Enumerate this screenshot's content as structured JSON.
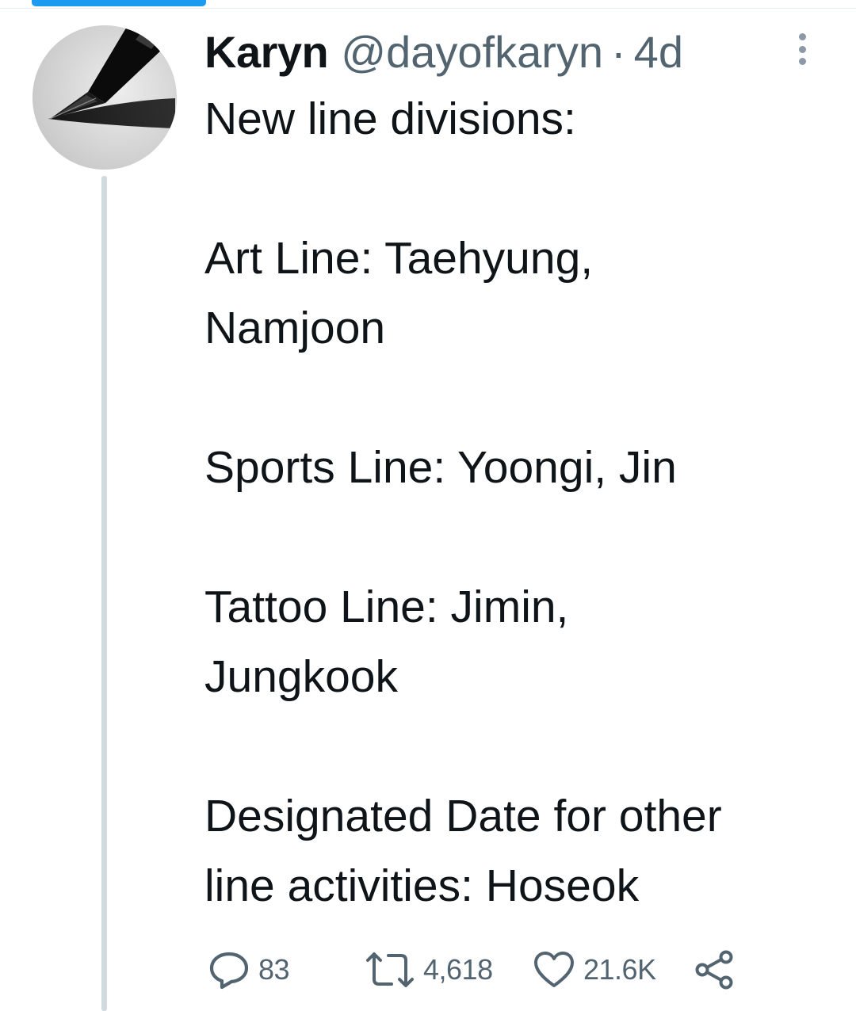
{
  "tweet": {
    "author_name": "Karyn",
    "handle": "@dayofkaryn",
    "separator": "·",
    "time": "4d",
    "text_lines": [
      "New line divisions:",
      "",
      "Art Line: Taehyung,",
      "Namjoon",
      "",
      "Sports Line: Yoongi, Jin",
      "",
      "Tattoo Line: Jimin,",
      "Jungkook",
      "",
      "Designated Date for other",
      "line activities: Hoseok"
    ],
    "actions": {
      "reply_count": "83",
      "retweet_count": "4,618",
      "like_count": "21.6K"
    }
  },
  "icons": {
    "reply": "reply-icon",
    "retweet": "retweet-icon",
    "like": "heart-icon",
    "share": "share-icon",
    "more": "more-vertical-icon"
  },
  "colors": {
    "accent": "#1d9bf0",
    "text_primary": "#0f1419",
    "text_secondary": "#536471",
    "thread_line": "#cfd9de"
  }
}
